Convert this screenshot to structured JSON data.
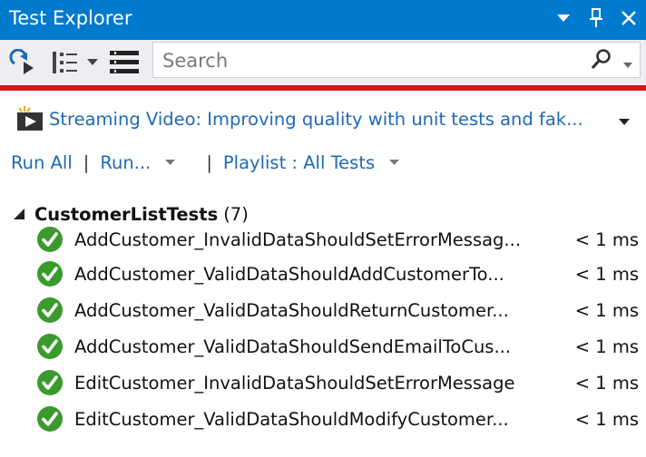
{
  "window": {
    "title": "Test Explorer"
  },
  "search": {
    "placeholder": "Search"
  },
  "streaming": {
    "text": "Streaming Video: Improving quality with unit tests and fak..."
  },
  "runbar": {
    "run_all": "Run All",
    "sep1": "|",
    "run": "Run...",
    "sep2": "|",
    "playlist": "Playlist : All Tests"
  },
  "group": {
    "name": "CustomerListTests",
    "count": "(7)"
  },
  "tests": [
    {
      "name": "AddCustomer_InvalidDataShouldSetErrorMessag...",
      "duration": "< 1 ms",
      "status": "passed"
    },
    {
      "name": "AddCustomer_ValidDataShouldAddCustomerTo...",
      "duration": "< 1 ms",
      "status": "passed"
    },
    {
      "name": "AddCustomer_ValidDataShouldReturnCustomer...",
      "duration": "< 1 ms",
      "status": "passed"
    },
    {
      "name": "AddCustomer_ValidDataShouldSendEmailToCus...",
      "duration": "< 1 ms",
      "status": "passed"
    },
    {
      "name": "EditCustomer_InvalidDataShouldSetErrorMessage",
      "duration": "< 1 ms",
      "status": "passed"
    },
    {
      "name": "EditCustomer_ValidDataShouldModifyCustomer...",
      "duration": "< 1 ms",
      "status": "passed"
    }
  ],
  "colors": {
    "titlebar": "#007acc",
    "link": "#1e69b8",
    "pass": "#3a9a2c",
    "separator": "#d11b1b"
  },
  "icons": {
    "window_dropdown": "chevron-down-icon",
    "pin": "pin-icon",
    "close": "close-icon",
    "refresh": "refresh-icon",
    "group_by": "group-by-icon",
    "group_by_dropdown": "chevron-down-icon",
    "list": "list-icon",
    "search": "search-icon",
    "video": "video-icon",
    "check": "check-circle-icon"
  }
}
